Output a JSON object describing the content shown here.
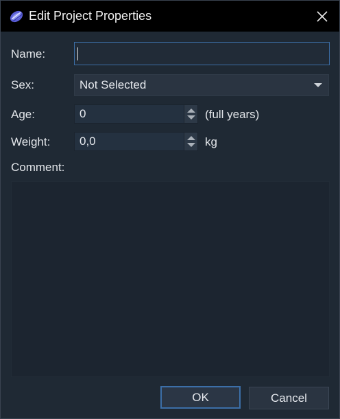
{
  "window": {
    "title": "Edit Project Properties",
    "icon": "app-logo-icon",
    "close_icon": "close-icon"
  },
  "form": {
    "name_label": "Name:",
    "name_value": "",
    "sex_label": "Sex:",
    "sex_value": "Not Selected",
    "age_label": "Age:",
    "age_value": "0",
    "age_unit": "(full years)",
    "weight_label": "Weight:",
    "weight_value": "0,0",
    "weight_unit": "kg",
    "comment_label": "Comment:",
    "comment_value": ""
  },
  "buttons": {
    "ok": "OK",
    "cancel": "Cancel"
  },
  "colors": {
    "background": "#1f2934",
    "titlebar": "#000000",
    "focus_accent": "#3c6fa8"
  }
}
